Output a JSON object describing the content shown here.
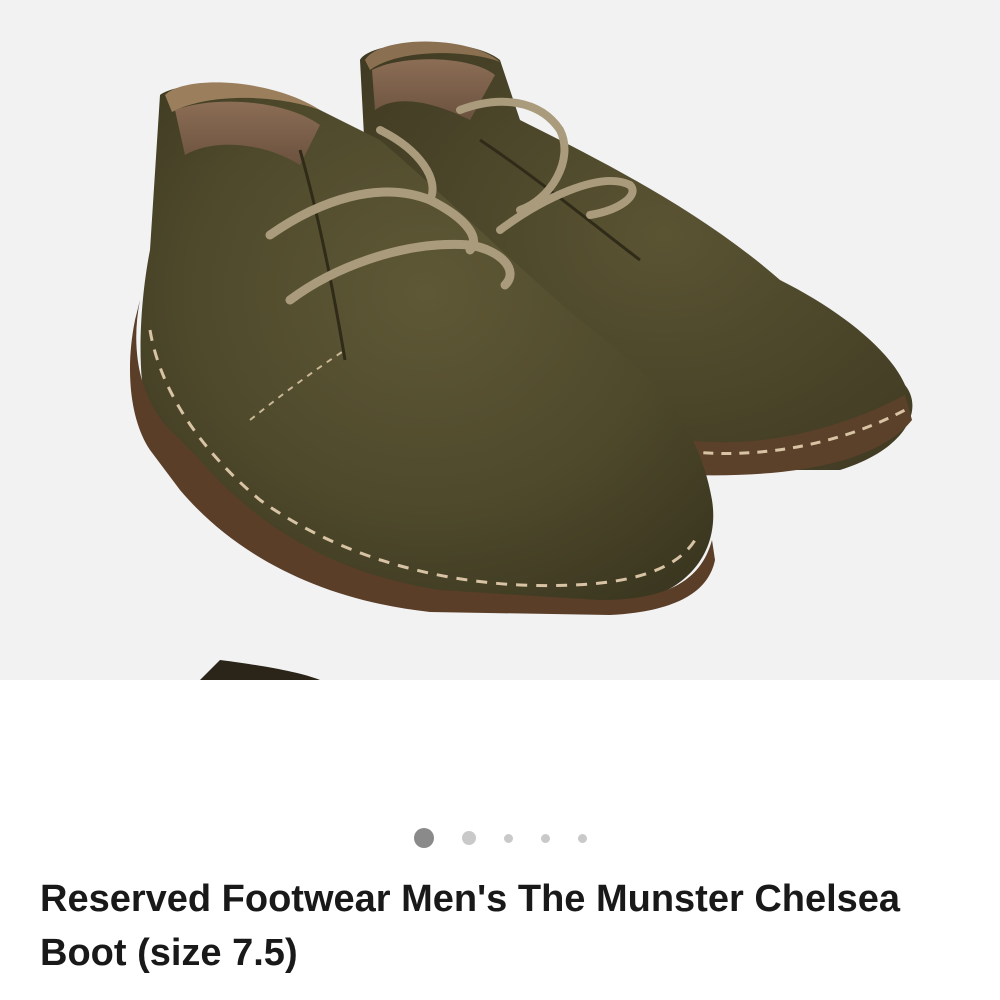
{
  "gallery": {
    "image_alt": "Olive suede lace-up boots",
    "image_count": 5,
    "active_index": 0
  },
  "listing": {
    "title": "Reserved Footwear Men's The Munster Chelsea Boot (size 7.5)"
  },
  "colors": {
    "suede": "#4f4a2c",
    "sole": "#5a3f2a",
    "lace": "#a99b7c",
    "background": "#f2f2f3",
    "dot_active": "#8a8a8a",
    "dot_inactive": "#c9c9c9"
  }
}
